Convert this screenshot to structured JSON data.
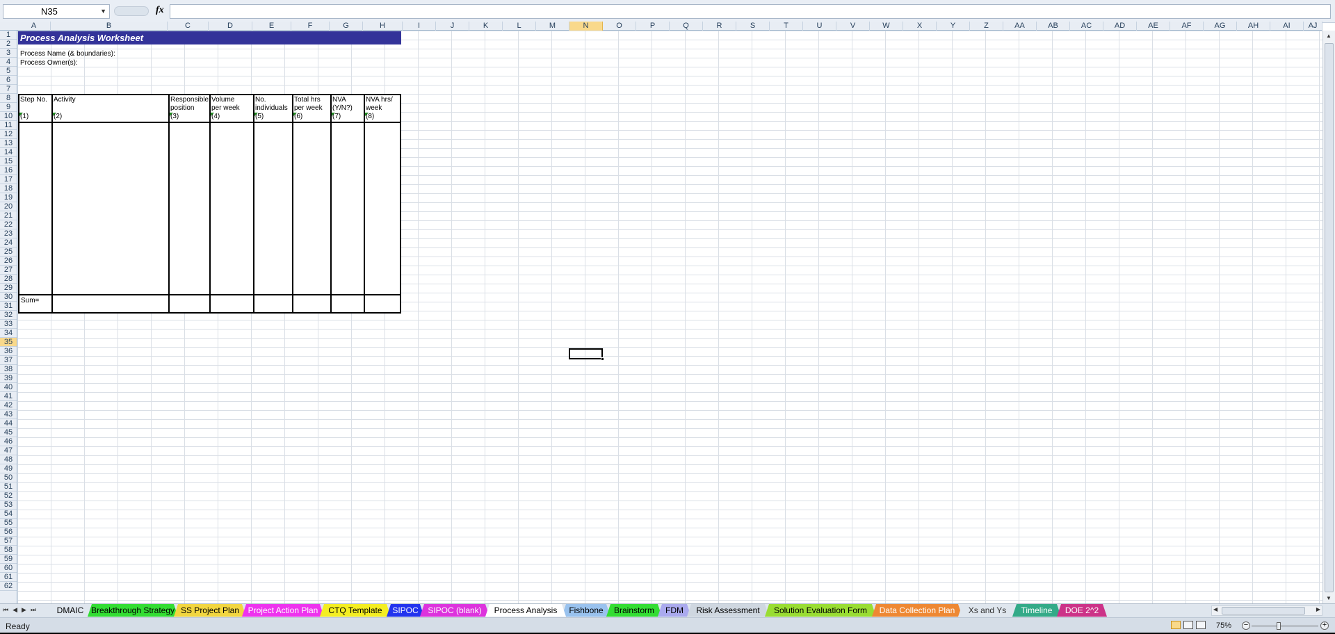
{
  "formula_bar": {
    "name_box": "N35",
    "fx_label": "fx",
    "formula": ""
  },
  "columns": [
    "A",
    "B",
    "C",
    "D",
    "E",
    "F",
    "G",
    "H",
    "I",
    "J",
    "K",
    "L",
    "M",
    "N",
    "O",
    "P",
    "Q",
    "R",
    "S",
    "T",
    "U",
    "V",
    "W",
    "X",
    "Y",
    "Z",
    "AA",
    "AB",
    "AC",
    "AD",
    "AE",
    "AF",
    "AG",
    "AH",
    "AI",
    "AJ"
  ],
  "selected_column": "N",
  "selected_row": 35,
  "rows_visible": 62,
  "sheet": {
    "title": "Process Analysis Worksheet",
    "process_name_label": "Process Name (& boundaries):",
    "process_owner_label": "Process Owner(s):",
    "table_headers": [
      {
        "line1": "Step No.",
        "line2": "",
        "num": "(1)"
      },
      {
        "line1": "Activity",
        "line2": "",
        "num": "(2)"
      },
      {
        "line1": "Responsible",
        "line2": "position",
        "num": "(3)"
      },
      {
        "line1": "Volume",
        "line2": "per week",
        "num": "(4)"
      },
      {
        "line1": "No.",
        "line2": "individuals",
        "num": "(5)"
      },
      {
        "line1": "Total hrs",
        "line2": "per week",
        "num": "(6)"
      },
      {
        "line1": "NVA",
        "line2": "(Y/N?)",
        "num": "(7)"
      },
      {
        "line1": "NVA hrs/",
        "line2": "week",
        "num": "(8)"
      }
    ],
    "sum_label": "Sum="
  },
  "sheet_tabs": [
    {
      "label": "DMAIC",
      "color": "#dfe6ee",
      "text": "#000000"
    },
    {
      "label": "Breakthrough Strategy",
      "color": "#33dd33",
      "text": "#000000"
    },
    {
      "label": "SS Project Plan",
      "color": "#f2d640",
      "text": "#000000"
    },
    {
      "label": "Project Action Plan",
      "color": "#ee33ee",
      "text": "#ffffff"
    },
    {
      "label": "CTQ Template",
      "color": "#f4ee22",
      "text": "#000000"
    },
    {
      "label": "SIPOC",
      "color": "#2233ee",
      "text": "#ffffff"
    },
    {
      "label": "SIPOC (blank)",
      "color": "#dd33dd",
      "text": "#ffffff"
    },
    {
      "label": "Process Analysis",
      "color": "#ffffff",
      "text": "#000000"
    },
    {
      "label": "Fishbone",
      "color": "#99c2ee",
      "text": "#000000"
    },
    {
      "label": "Brainstorm",
      "color": "#33dd33",
      "text": "#000000"
    },
    {
      "label": "FDM",
      "color": "#aaaaee",
      "text": "#000000"
    },
    {
      "label": "Risk Assessment",
      "color": "#cfd7e0",
      "text": "#000000"
    },
    {
      "label": "Solution Evaluation Form",
      "color": "#99dd33",
      "text": "#000000"
    },
    {
      "label": "Data Collection Plan",
      "color": "#ee8833",
      "text": "#ffffff"
    },
    {
      "label": "Xs and Ys",
      "color": "#dfe6ee",
      "text": "#333333"
    },
    {
      "label": "Timeline",
      "color": "#33aa88",
      "text": "#ffffff"
    },
    {
      "label": "DOE 2^2",
      "color": "#cc3388",
      "text": "#ffffff"
    }
  ],
  "status_bar": {
    "status": "Ready",
    "zoom": "75%"
  }
}
